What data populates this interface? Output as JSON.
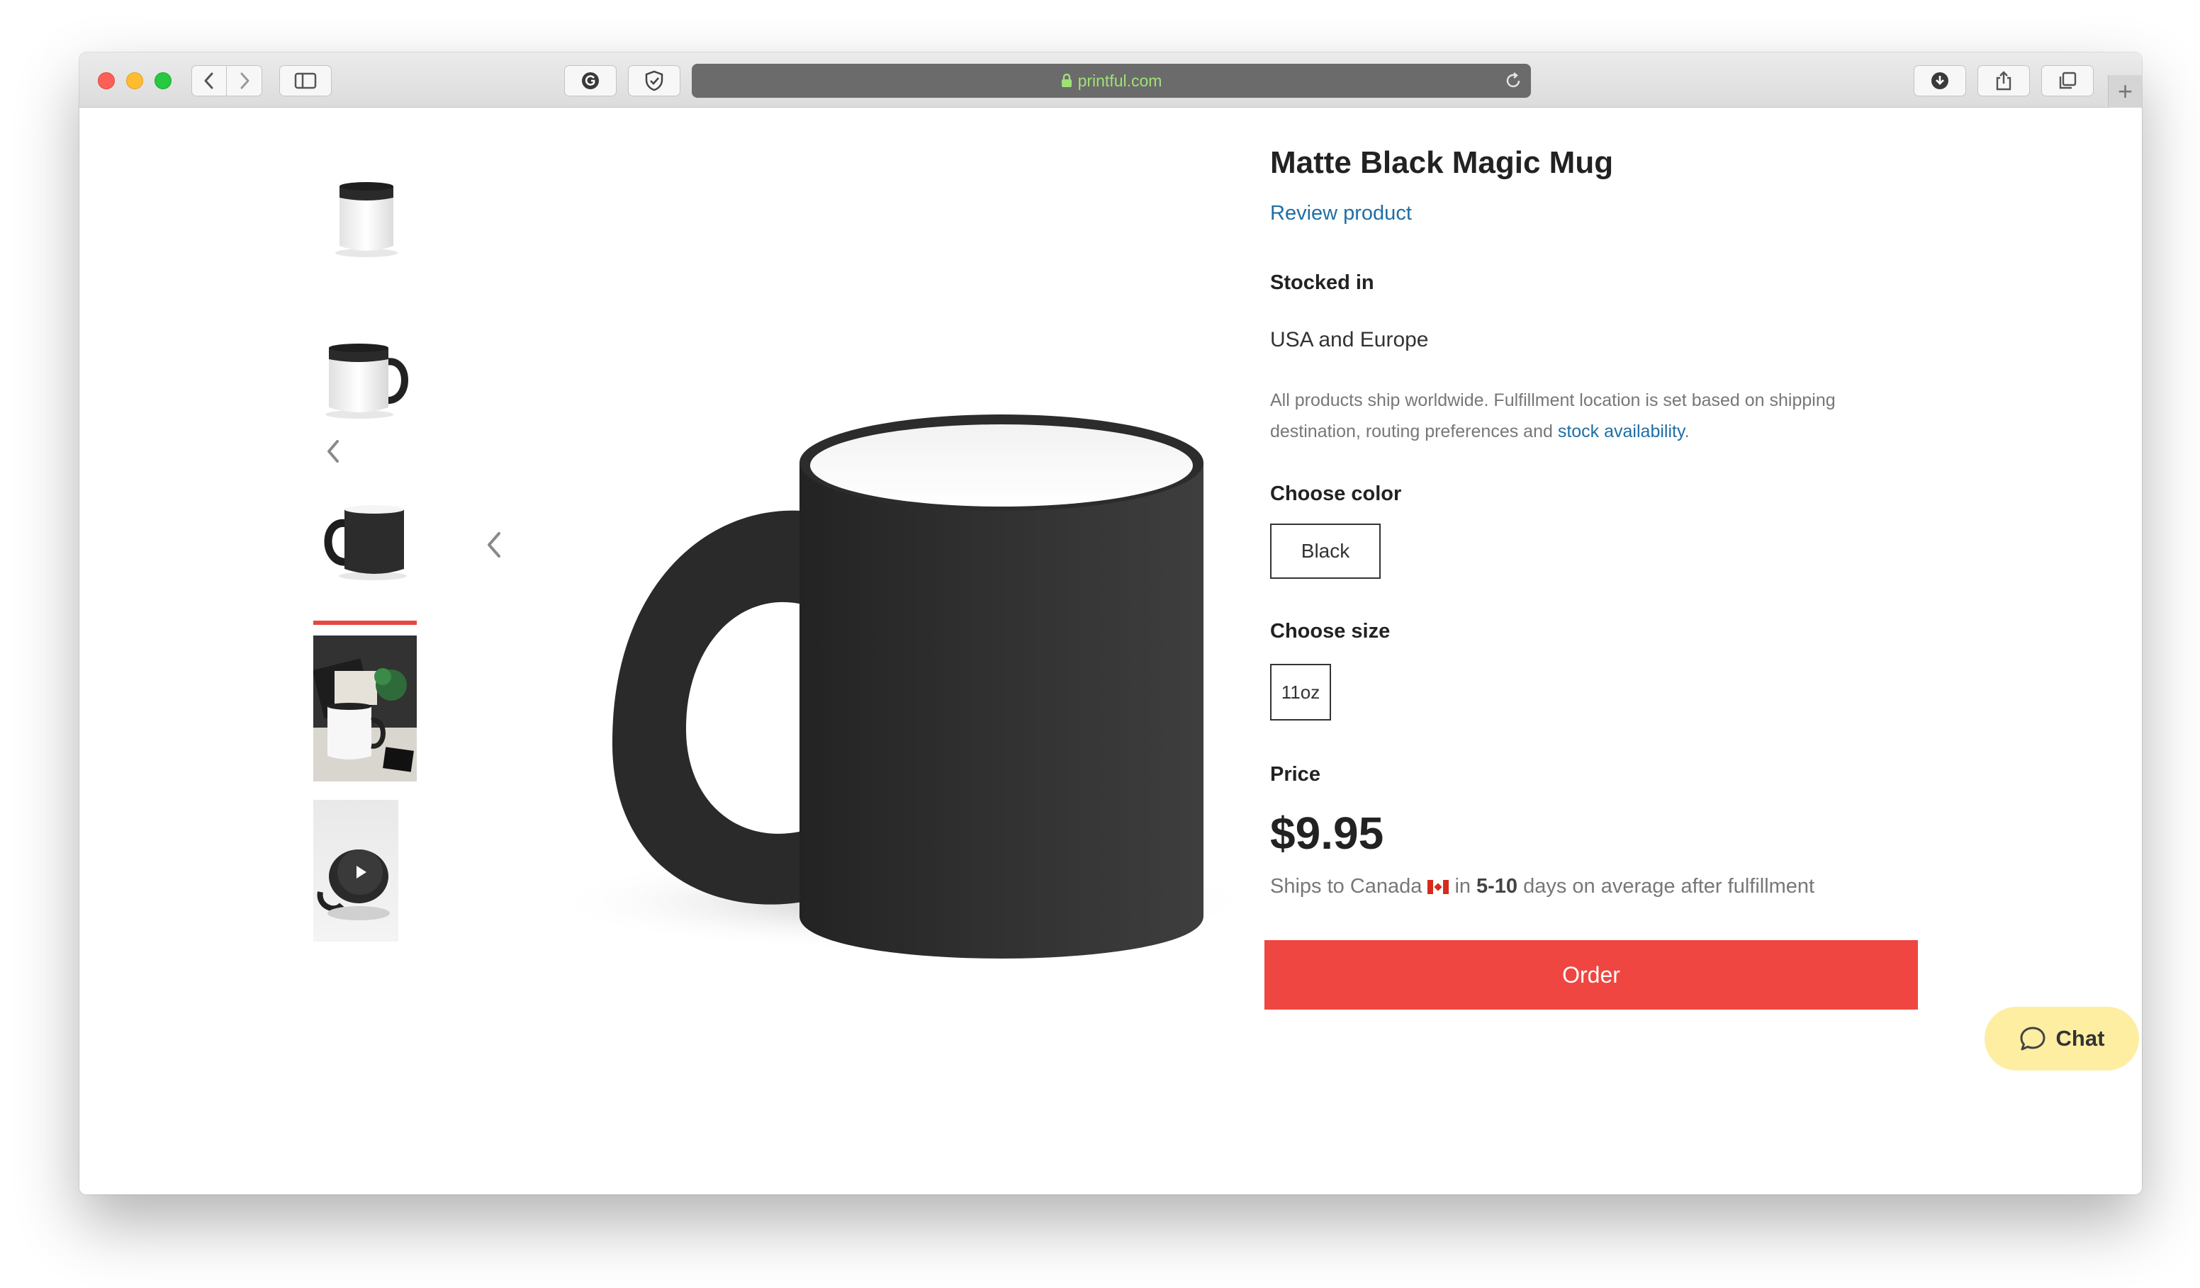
{
  "browser": {
    "url": "printful.com",
    "icons": {
      "back": "chevron-left-icon",
      "forward": "chevron-right-icon",
      "sidebar": "sidebar-icon",
      "extension_1": "grammarly-icon",
      "extension_2": "shield-icon",
      "lock": "lock-icon",
      "reload": "reload-icon",
      "download": "download-icon",
      "share": "share-icon",
      "tabs": "tabs-icon",
      "new_tab": "plus-icon"
    },
    "new_tab_label": "+"
  },
  "gallery": {
    "thumbnails": [
      {
        "name": "mug-front",
        "type": "image"
      },
      {
        "name": "mug-handle-right",
        "type": "image"
      },
      {
        "name": "mug-handle-left",
        "type": "image",
        "active": true
      },
      {
        "name": "mug-lifestyle",
        "type": "image"
      },
      {
        "name": "mug-video",
        "type": "video"
      }
    ],
    "accent_color": "#e8473f"
  },
  "product": {
    "title": "Matte Black Magic Mug",
    "review_link": "Review product",
    "stocked_label": "Stocked in",
    "stocked_value": "USA and Europe",
    "ship_note_text": "All products ship worldwide. Fulfillment location is set based on shipping destination, routing preferences and ",
    "ship_note_link": "stock availability",
    "ship_note_end": ".",
    "color_label": "Choose color",
    "color_option": "Black",
    "size_label": "Choose size",
    "size_option": "11oz",
    "price_label": "Price",
    "price": "$9.95",
    "ships_prefix": "Ships to Canada",
    "ships_in": "in",
    "ships_days": "5-10",
    "ships_suffix": "days on average after fulfillment",
    "order_button": "Order",
    "order_color": "#ef4641",
    "link_color": "#1f6ea5"
  },
  "chat": {
    "label": "Chat",
    "icon": "chat-bubble-icon",
    "background": "#fdeea2"
  }
}
